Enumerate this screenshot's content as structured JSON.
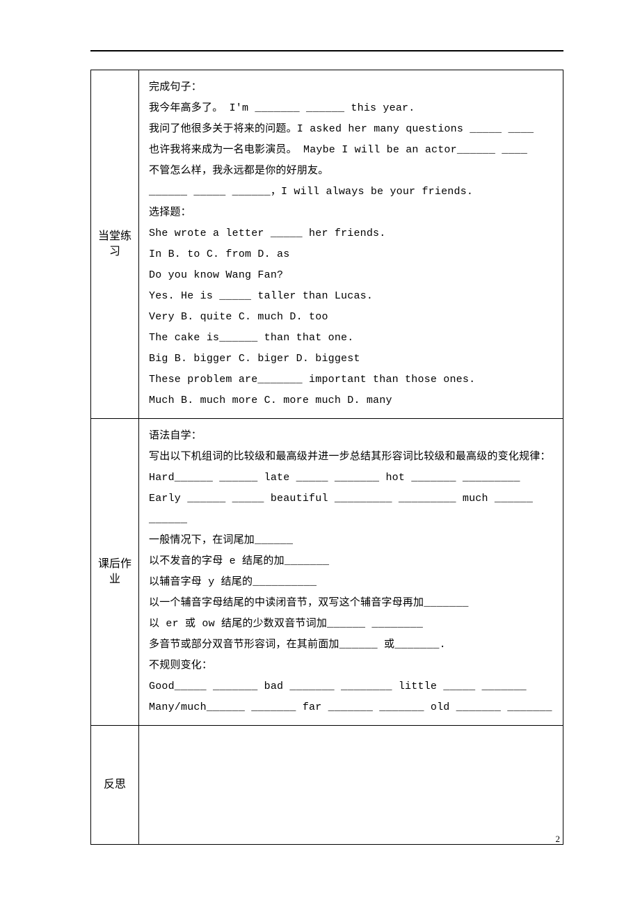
{
  "sections": {
    "practice": {
      "label": "当堂练\n习",
      "lines": [
        "完成句子：",
        "我今年高多了。 I'm _______ ______ this year.",
        "我问了他很多关于将来的问题。I asked her many questions _____  ____",
        "也许我将来成为一名电影演员。  Maybe I will be an actor______  ____",
        "不管怎么样，我永远都是你的好朋友。",
        "______  _____ ______，I will always be your friends.",
        "选择题：",
        "She wrote a letter _____ her friends.",
        "In    B. to   C. from   D. as",
        "Do you know Wang Fan?",
        "Yes. He is _____ taller than Lucas.",
        "Very   B. quite   C. much   D. too",
        "The cake is______ than that one.",
        "Big    B. bigger   C. biger    D. biggest",
        "These problem are_______ important than those ones.",
        "Much   B. much more   C. more much    D. many"
      ]
    },
    "homework": {
      "label": "课后作\n业",
      "lines": [
        "语法自学：",
        "写出以下机组词的比较级和最高级并进一步总结其形容词比较级和最高级的变化规律：",
        "Hard______ ______    late _____ _______     hot _______ _________",
        "Early ______ _____    beautiful _________ _________ much ______ ______",
        "一般情况下，在词尾加______",
        "以不发音的字母 e 结尾的加_______",
        "以辅音字母 y 结尾的__________",
        "以一个辅音字母结尾的中读闭音节，双写这个辅音字母再加_______",
        "以 er 或 ow 结尾的少数双音节词加______ ________",
        "多音节或部分双音节形容词，在其前面加______ 或_______.",
        "不规则变化：",
        "Good_____ _______      bad _______ ________    little _____ _______",
        "Many/much______ _______ far _______ _______    old _______ _______"
      ]
    },
    "reflection": {
      "label": "反思",
      "lines": []
    }
  },
  "page_number": "2"
}
